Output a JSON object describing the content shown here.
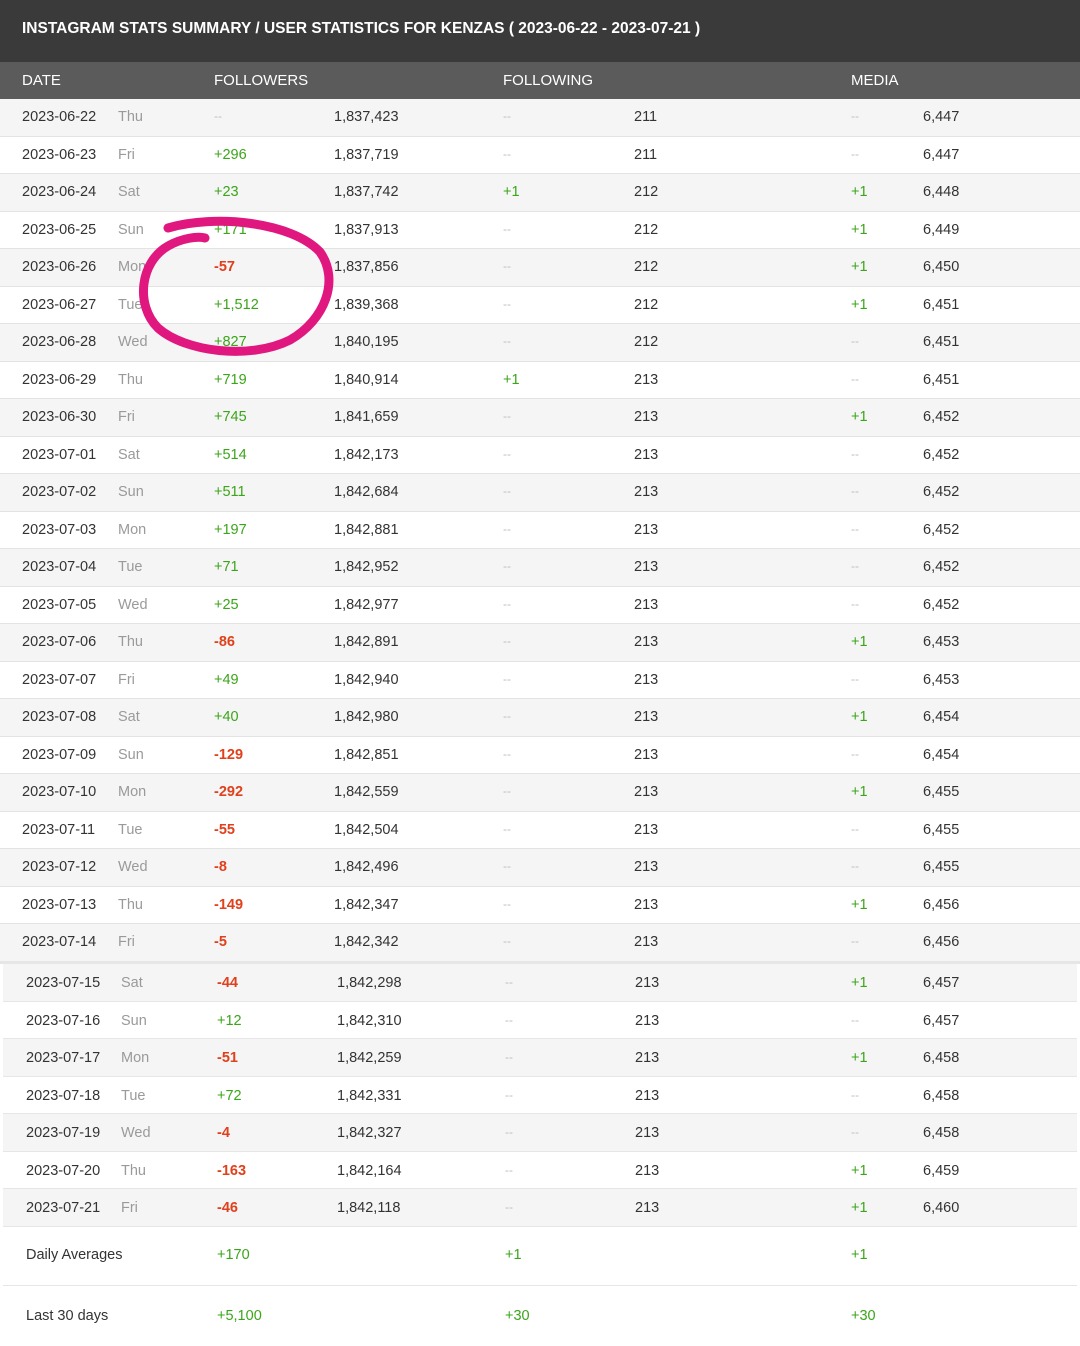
{
  "title": "INSTAGRAM STATS SUMMARY / USER STATISTICS FOR KENZAS ( 2023-06-22 - 2023-07-21 )",
  "columns": {
    "date": "DATE",
    "followers": "FOLLOWERS",
    "following": "FOLLOWING",
    "media": "MEDIA"
  },
  "rows": [
    {
      "date": "2023-06-22",
      "day": "Thu",
      "followers_change": "--",
      "followers": "1,837,423",
      "following_change": "--",
      "following": "211",
      "media_change": "--",
      "media": "6,447"
    },
    {
      "date": "2023-06-23",
      "day": "Fri",
      "followers_change": "+296",
      "followers": "1,837,719",
      "following_change": "--",
      "following": "211",
      "media_change": "--",
      "media": "6,447"
    },
    {
      "date": "2023-06-24",
      "day": "Sat",
      "followers_change": "+23",
      "followers": "1,837,742",
      "following_change": "+1",
      "following": "212",
      "media_change": "+1",
      "media": "6,448"
    },
    {
      "date": "2023-06-25",
      "day": "Sun",
      "followers_change": "+171",
      "followers": "1,837,913",
      "following_change": "--",
      "following": "212",
      "media_change": "+1",
      "media": "6,449"
    },
    {
      "date": "2023-06-26",
      "day": "Mon",
      "followers_change": "-57",
      "followers": "1,837,856",
      "following_change": "--",
      "following": "212",
      "media_change": "+1",
      "media": "6,450"
    },
    {
      "date": "2023-06-27",
      "day": "Tue",
      "followers_change": "+1,512",
      "followers": "1,839,368",
      "following_change": "--",
      "following": "212",
      "media_change": "+1",
      "media": "6,451"
    },
    {
      "date": "2023-06-28",
      "day": "Wed",
      "followers_change": "+827",
      "followers": "1,840,195",
      "following_change": "--",
      "following": "212",
      "media_change": "--",
      "media": "6,451"
    },
    {
      "date": "2023-06-29",
      "day": "Thu",
      "followers_change": "+719",
      "followers": "1,840,914",
      "following_change": "+1",
      "following": "213",
      "media_change": "--",
      "media": "6,451"
    },
    {
      "date": "2023-06-30",
      "day": "Fri",
      "followers_change": "+745",
      "followers": "1,841,659",
      "following_change": "--",
      "following": "213",
      "media_change": "+1",
      "media": "6,452"
    },
    {
      "date": "2023-07-01",
      "day": "Sat",
      "followers_change": "+514",
      "followers": "1,842,173",
      "following_change": "--",
      "following": "213",
      "media_change": "--",
      "media": "6,452"
    },
    {
      "date": "2023-07-02",
      "day": "Sun",
      "followers_change": "+511",
      "followers": "1,842,684",
      "following_change": "--",
      "following": "213",
      "media_change": "--",
      "media": "6,452"
    },
    {
      "date": "2023-07-03",
      "day": "Mon",
      "followers_change": "+197",
      "followers": "1,842,881",
      "following_change": "--",
      "following": "213",
      "media_change": "--",
      "media": "6,452"
    },
    {
      "date": "2023-07-04",
      "day": "Tue",
      "followers_change": "+71",
      "followers": "1,842,952",
      "following_change": "--",
      "following": "213",
      "media_change": "--",
      "media": "6,452"
    },
    {
      "date": "2023-07-05",
      "day": "Wed",
      "followers_change": "+25",
      "followers": "1,842,977",
      "following_change": "--",
      "following": "213",
      "media_change": "--",
      "media": "6,452"
    },
    {
      "date": "2023-07-06",
      "day": "Thu",
      "followers_change": "-86",
      "followers": "1,842,891",
      "following_change": "--",
      "following": "213",
      "media_change": "+1",
      "media": "6,453"
    },
    {
      "date": "2023-07-07",
      "day": "Fri",
      "followers_change": "+49",
      "followers": "1,842,940",
      "following_change": "--",
      "following": "213",
      "media_change": "--",
      "media": "6,453"
    },
    {
      "date": "2023-07-08",
      "day": "Sat",
      "followers_change": "+40",
      "followers": "1,842,980",
      "following_change": "--",
      "following": "213",
      "media_change": "+1",
      "media": "6,454"
    },
    {
      "date": "2023-07-09",
      "day": "Sun",
      "followers_change": "-129",
      "followers": "1,842,851",
      "following_change": "--",
      "following": "213",
      "media_change": "--",
      "media": "6,454"
    },
    {
      "date": "2023-07-10",
      "day": "Mon",
      "followers_change": "-292",
      "followers": "1,842,559",
      "following_change": "--",
      "following": "213",
      "media_change": "+1",
      "media": "6,455"
    },
    {
      "date": "2023-07-11",
      "day": "Tue",
      "followers_change": "-55",
      "followers": "1,842,504",
      "following_change": "--",
      "following": "213",
      "media_change": "--",
      "media": "6,455"
    },
    {
      "date": "2023-07-12",
      "day": "Wed",
      "followers_change": "-8",
      "followers": "1,842,496",
      "following_change": "--",
      "following": "213",
      "media_change": "--",
      "media": "6,455"
    },
    {
      "date": "2023-07-13",
      "day": "Thu",
      "followers_change": "-149",
      "followers": "1,842,347",
      "following_change": "--",
      "following": "213",
      "media_change": "+1",
      "media": "6,456"
    },
    {
      "date": "2023-07-14",
      "day": "Fri",
      "followers_change": "-5",
      "followers": "1,842,342",
      "following_change": "--",
      "following": "213",
      "media_change": "--",
      "media": "6,456"
    }
  ],
  "rows2": [
    {
      "date": "2023-07-15",
      "day": "Sat",
      "followers_change": "-44",
      "followers": "1,842,298",
      "following_change": "--",
      "following": "213",
      "media_change": "+1",
      "media": "6,457"
    },
    {
      "date": "2023-07-16",
      "day": "Sun",
      "followers_change": "+12",
      "followers": "1,842,310",
      "following_change": "--",
      "following": "213",
      "media_change": "--",
      "media": "6,457"
    },
    {
      "date": "2023-07-17",
      "day": "Mon",
      "followers_change": "-51",
      "followers": "1,842,259",
      "following_change": "--",
      "following": "213",
      "media_change": "+1",
      "media": "6,458"
    },
    {
      "date": "2023-07-18",
      "day": "Tue",
      "followers_change": "+72",
      "followers": "1,842,331",
      "following_change": "--",
      "following": "213",
      "media_change": "--",
      "media": "6,458"
    },
    {
      "date": "2023-07-19",
      "day": "Wed",
      "followers_change": "-4",
      "followers": "1,842,327",
      "following_change": "--",
      "following": "213",
      "media_change": "--",
      "media": "6,458"
    },
    {
      "date": "2023-07-20",
      "day": "Thu",
      "followers_change": "-163",
      "followers": "1,842,164",
      "following_change": "--",
      "following": "213",
      "media_change": "+1",
      "media": "6,459"
    },
    {
      "date": "2023-07-21",
      "day": "Fri",
      "followers_change": "-46",
      "followers": "1,842,118",
      "following_change": "--",
      "following": "213",
      "media_change": "+1",
      "media": "6,460"
    }
  ],
  "daily_averages": {
    "label": "Daily Averages",
    "followers": "+170",
    "following": "+1",
    "media": "+1"
  },
  "last_30_days": {
    "label": "Last 30 days",
    "followers": "+5,100",
    "following": "+30",
    "media": "+30"
  },
  "colors": {
    "positive": "#3ba51a",
    "negative": "#e0401c",
    "annotation": "#e0177f"
  }
}
